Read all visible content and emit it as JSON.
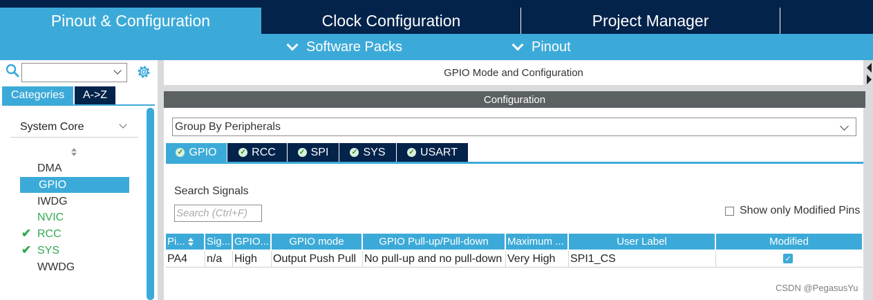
{
  "top_tabs": [
    {
      "label": "Pinout & Configuration"
    },
    {
      "label": "Clock Configuration"
    },
    {
      "label": "Project Manager"
    }
  ],
  "sub_menu": [
    {
      "label": "Software Packs"
    },
    {
      "label": "Pinout"
    }
  ],
  "left": {
    "category_tabs": [
      "Categories",
      "A->Z"
    ],
    "group_label": "System Core",
    "items": [
      {
        "label": "DMA",
        "status": "none"
      },
      {
        "label": "GPIO",
        "status": "selected"
      },
      {
        "label": "IWDG",
        "status": "none"
      },
      {
        "label": "NVIC",
        "status": "configured"
      },
      {
        "label": "RCC",
        "status": "checked"
      },
      {
        "label": "SYS",
        "status": "checked"
      },
      {
        "label": "WWDG",
        "status": "none"
      }
    ]
  },
  "main": {
    "mode_title": "GPIO Mode and Configuration",
    "config_header": "Configuration",
    "group_by": "Group By Peripherals",
    "peripheral_tabs": [
      "GPIO",
      "RCC",
      "SPI",
      "SYS",
      "USART"
    ],
    "search_label": "Search Signals",
    "search_placeholder": "Search (Ctrl+F)",
    "show_modified_label": "Show only Modified Pins",
    "table": {
      "headers": [
        "Pi...",
        "Sig...",
        "GPIO...",
        "GPIO mode",
        "GPIO Pull-up/Pull-down",
        "Maximum ...",
        "User Label",
        "Modified"
      ],
      "rows": [
        {
          "pin": "PA4",
          "signal": "n/a",
          "output_level": "High",
          "mode": "Output Push Pull",
          "pull": "No pull-up and no pull-down",
          "speed": "Very High",
          "label": "SPI1_CS",
          "modified": true
        }
      ]
    }
  },
  "watermark": "CSDN @PegasusYu",
  "colors": {
    "navy": "#03234b",
    "accent": "#3caad8",
    "config_header": "#5b6063",
    "ok_green": "#34a853"
  }
}
